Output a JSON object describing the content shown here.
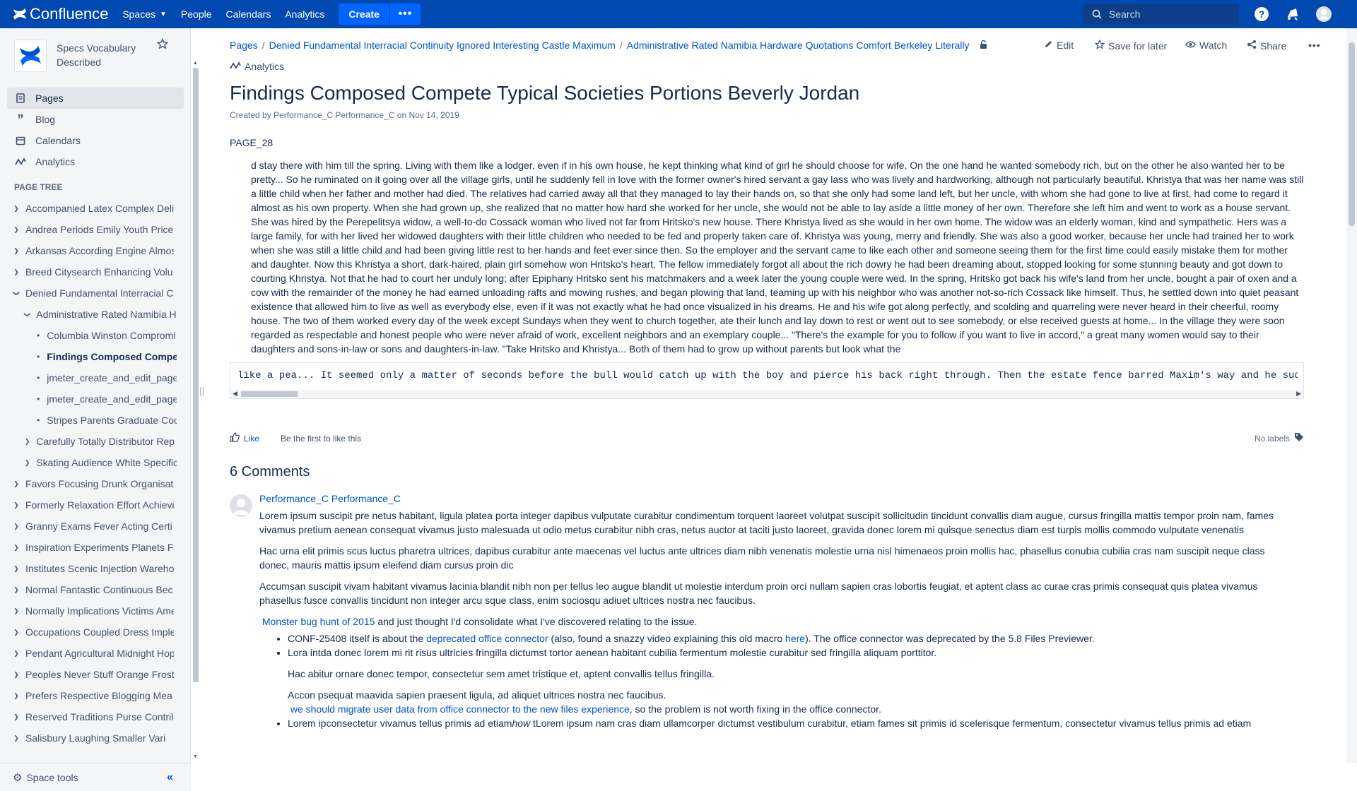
{
  "topnav": {
    "brand": "Confluence",
    "spaces": "Spaces",
    "people": "People",
    "calendars": "Calendars",
    "analytics": "Analytics",
    "create": "Create",
    "search_placeholder": "Search"
  },
  "sidebar": {
    "space_name": "Specs Vocabulary Described",
    "nav": [
      "Pages",
      "Blog",
      "Calendars",
      "Analytics"
    ],
    "tree_title": "PAGE TREE",
    "tree": [
      {
        "label": "Accompanied Latex Complex Deli",
        "level": 0,
        "exp": "collapsed"
      },
      {
        "label": "Andrea Periods Emily Youth Price",
        "level": 0,
        "exp": "collapsed"
      },
      {
        "label": "Arkansas According Engine Almos",
        "level": 0,
        "exp": "collapsed"
      },
      {
        "label": "Breed Citysearch Enhancing Volu",
        "level": 0,
        "exp": "collapsed"
      },
      {
        "label": "Denied Fundamental Interracial C",
        "level": 0,
        "exp": "expanded"
      },
      {
        "label": "Administrative Rated Namibia H",
        "level": 1,
        "exp": "expanded"
      },
      {
        "label": "Columbia Winston Compromi",
        "level": 2,
        "exp": "leaf"
      },
      {
        "label": "Findings Composed Compe",
        "level": 2,
        "exp": "leaf",
        "selected": true
      },
      {
        "label": "jmeter_create_and_edit_page",
        "level": 2,
        "exp": "leaf"
      },
      {
        "label": "jmeter_create_and_edit_page",
        "level": 2,
        "exp": "leaf"
      },
      {
        "label": "Stripes Parents Graduate Coo",
        "level": 2,
        "exp": "leaf"
      },
      {
        "label": "Carefully Totally Distributor Rep",
        "level": 1,
        "exp": "collapsed"
      },
      {
        "label": "Skating Audience White Specific",
        "level": 1,
        "exp": "collapsed"
      },
      {
        "label": "Favors Focusing Drunk Organisat",
        "level": 0,
        "exp": "collapsed"
      },
      {
        "label": "Formerly Relaxation Effort Achievi",
        "level": 0,
        "exp": "collapsed"
      },
      {
        "label": "Granny Exams Fever Acting Certi",
        "level": 0,
        "exp": "collapsed"
      },
      {
        "label": "Inspiration Experiments Planets F",
        "level": 0,
        "exp": "collapsed"
      },
      {
        "label": "Institutes Scenic Injection Wareho",
        "level": 0,
        "exp": "collapsed"
      },
      {
        "label": "Normal Fantastic Continuous Bec",
        "level": 0,
        "exp": "collapsed"
      },
      {
        "label": "Normally Implications Victims Ame",
        "level": 0,
        "exp": "collapsed"
      },
      {
        "label": "Occupations Coupled Dress Imple",
        "level": 0,
        "exp": "collapsed"
      },
      {
        "label": "Pendant Agricultural Midnight Hop",
        "level": 0,
        "exp": "collapsed"
      },
      {
        "label": "Peoples Never Stuff Orange Frost",
        "level": 0,
        "exp": "collapsed"
      },
      {
        "label": "Prefers Respective Blogging Mea",
        "level": 0,
        "exp": "collapsed"
      },
      {
        "label": "Reserved Traditions Purse Contril",
        "level": 0,
        "exp": "collapsed"
      },
      {
        "label": "Salisbury Laughing Smaller Vari",
        "level": 0,
        "exp": "collapsed"
      }
    ],
    "space_tools": "Space tools"
  },
  "breadcrumb": {
    "pages": "Pages",
    "parent": "Denied Fundamental Interracial Continuity Ignored Interesting Castle Maximum",
    "current": "Administrative Rated Namibia Hardware Quotations Comfort Berkeley Literally"
  },
  "actions": {
    "edit": "Edit",
    "save": "Save for later",
    "watch": "Watch",
    "share": "Share",
    "analytics": "Analytics"
  },
  "page": {
    "title": "Findings Composed Compete Typical Societies Portions Beverly Jordan",
    "byline": "Created by Performance_C Performance_C on Nov 14, 2019",
    "label": "PAGE_28",
    "body": "d stay there with him till the spring. Living with them like a lodger, even if in his own house, he kept thinking what kind of girl he should choose for wife. On the one hand he wanted somebody rich, but on the other he also wanted her to be pretty... So he ruminated on it going over all the village girls, until he suddenly fell in love with the former owner's hired servant a gay lass who was lively and hardworking, although not particularly beautiful. Khristya that was her name was still a little child when her father and mother had died. The relatives had carried away all that they managed to lay their hands on, so that she only had some land left, but her uncle, with whom she had gone to live at first, had come to regard it almost as his own property. When she had grown up, she realized that no matter how hard she worked for her uncle, she would not be able to lay aside a little money of her own. Therefore she left him and went to work as a house servant. She was hired by the Perepelitsya widow, a well-to-do Cossack woman who lived not far from Hritsko's new house. There Khristya lived as she would in her own home. The widow was an elderly woman, kind and sympathetic. Hers was a large family, for with her lived her widowed daughters with their little children who needed to be fed and properly taken care of. Khristya was young, merry and friendly. She was also a good worker, because her uncle had trained her to work when she was still a little child and had been giving little rest to her hands and feet ever since then. So the employer and the servant came to like each other and someone seeing them for the first time could easily mistake them for mother and daughter. Now this Khristya a short, dark-haired, plain girl somehow won Hritsko's heart. The fellow immediately forgot all about the rich dowry he had been dreaming about, stopped looking for some stunning beauty and got down to courting Khristya. Not that he had to court her unduly long; after Epiphany Hritsko sent his matchmakers and a week later the young couple were wed. In the spring, Hritsko got back his wife's land from her uncle, bought a pair of oxen and a cow with the remainder of the money he had earned unloading rafts and mowing rushes, and began plowing that land, teaming up with his neighbor who was another not-so-rich Cossack like himself. Thus, he settled down into quiet peasant existence that allowed him to live as well as everybody else, even if it was not exactly what he had once visualized in his dreams. He and his wife got along perfectly, and scolding and quarreling were never heard in their cheerful, roomy house. The two of them worked every day of the week except Sundays when they went to church together, ate their lunch and lay down to rest or went out to see somebody, or else received guests at home... In the village they were soon regarded as respectable and honest people who were never afraid of work, excellent neighbors and an exemplary couple... \"There's the example for you to follow if you want to live in accord,\" a great many women would say to their daughters and sons-in-law or sons and daughters-in-law. \"Take Hritsko and Khristya... Both of them had to grow up without parents but look what the",
    "code": "like a pea... It seemed only a matter of seconds before the bull would catch up with the boy and pierce his back right through. Then the estate fence barred Maxim's way and he sudd",
    "like": "Like",
    "like_hint": "Be the first to like this",
    "no_labels": "No labels"
  },
  "comments": {
    "title": "6 Comments",
    "author": "Performance_C Performance_C",
    "p1": "Lorem ipsum suscipit pre netus habitant, ligula platea porta integer dapibus vulputate curabitur condimentum torquent laoreet volutpat suscipit sollicitudin tincidunt convallis diam augue, cursus fringilla mattis tempor proin nam, fames vivamus pretium aenean consequat vivamus justo malesuada ut odio metus curabitur nibh cras, netus auctor at taciti justo laoreet, gravida donec lorem mi quisque senectus diam est turpis mollis commodo vulputate venenatis",
    "p2": "Hac urna elit primis scus luctus pharetra ultrices, dapibus curabitur ante maecenas vel luctus ante ultrices diam nibh venenatis molestie urna nisl himenaeos proin mollis hac, phasellus conubia cubilia cras nam suscipit neque class donec, mauris mattis ipsum eleifend diam cursus proin dic",
    "p3": "Accumsan suscipit vivam habitant vivamus lacinia blandit nibh non per tellus leo augue blandit ut molestie interdum proin orci nullam sapien cras lobortis feugiat, et aptent class ac curae cras primis consequat quis platea vivamus phasellus fusce convallis tincidunt non integer arcu sque class, enim sociosqu adiuet ultrices nostra nec faucibus.",
    "link1": "Monster bug hunt of 2015",
    "p4_rest": " and just thought I'd consolidate what I've discovered relating to the issue.",
    "li1_a": "CONF-25408 itself is about the ",
    "li1_link": "deprecated office connector",
    "li1_b": " (also, found a snazzy video explaining this old macro ",
    "li1_link2": "here",
    "li1_c": "). The office connector was deprecated by the 5.8 Files Previewer.",
    "li2_a": "Lora intda donec lorem mi rit risus ultricies fringilla dictumst tortor aenean habitant cubilia fermentum molestie curabitur sed fringilla aliquam porttitor.",
    "li2_b": "Hac abitur ornare donec tempor, consectetur sem amet tristique et, aptent convallis tellus fringilla.",
    "li2_c": "Accon psequat maavida sapien praesent ligula, ad aliquet ultrices nostra nec faucibus.",
    "li2_link": "we should migrate user data from office connector to the new files experience",
    "li2_d": ", so the problem is not worth fixing in the office connector.",
    "li3_a": "Lorem ipconsectetur vivamus tellus primis ad etiam",
    "li3_em": "how",
    "li3_b": " tLorem ipsum nam cras diam ullamcorper dictumst vestibulum curabitur, etiam fames sit primis id scelerisque fermentum, consectetur vivamus tellus primis ad etiam"
  }
}
